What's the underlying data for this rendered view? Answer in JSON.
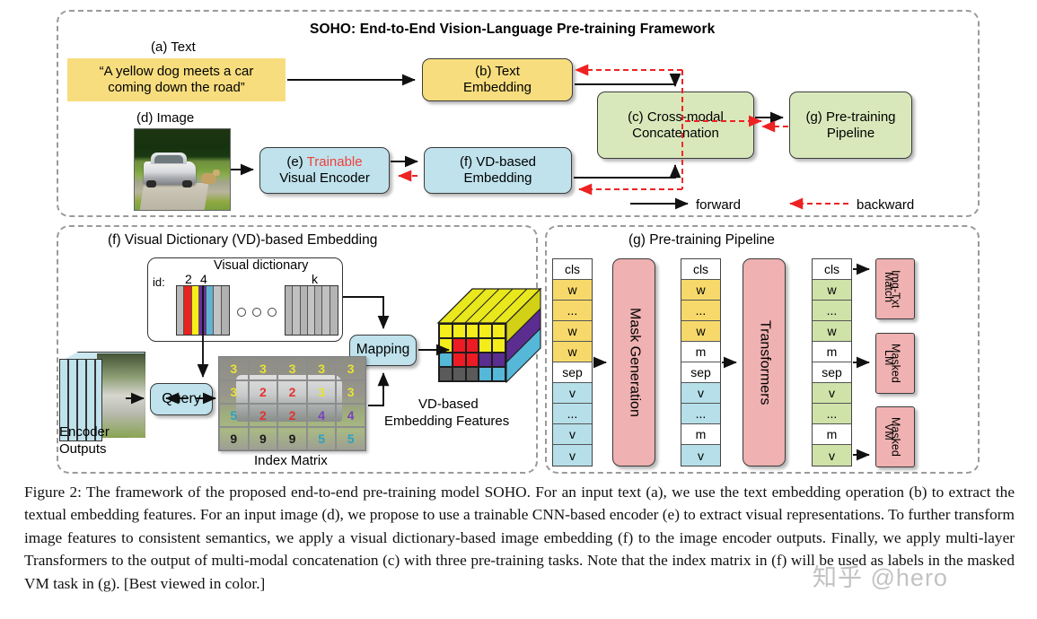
{
  "figure": {
    "top_panel_title": "SOHO: End-to-End Vision-Language Pre-training Framework",
    "labels": {
      "a_text": "(a) Text",
      "d_image": "(d) Image"
    },
    "text_sample_line1": "“A yellow dog meets a car",
    "text_sample_line2": "coming down the road”",
    "boxes": {
      "b_line1": "(b) Text",
      "b_line2": "Embedding",
      "e_line1_prefix": "(e) ",
      "e_line1_red": "Trainable",
      "e_line2": "Visual Encoder",
      "f_line1": "(f) VD-based",
      "f_line2": "Embedding",
      "c_line1": "(c) Cross-modal",
      "c_line2": "Concatenation",
      "g_line1": "(g) Pre-training",
      "g_line2": "Pipeline"
    },
    "legend": {
      "forward": "forward",
      "backward": "backward"
    }
  },
  "panel_f": {
    "title": "(f) Visual Dictionary (VD)-based Embedding",
    "visual_dictionary_title": "Visual dictionary",
    "id_label": "id:",
    "id_2": "2",
    "id_4": "4",
    "id_k": "k",
    "encoder_outputs_line1": "Encoder",
    "encoder_outputs_line2": "Outputs",
    "query_label": "Query",
    "mapping_label": "Mapping",
    "index_matrix_label": "Index Matrix",
    "vd_features_line1": "VD-based",
    "vd_features_line2": "Embedding Features",
    "dictionary_bars": [
      {
        "color": "#b9b9b9"
      },
      {
        "color": "#e8231f"
      },
      {
        "color": "#f9ee16"
      },
      {
        "color": "#6b2fa0"
      },
      {
        "color": "#5fb4d4"
      },
      {
        "color": "#c3c3c3"
      },
      {
        "color": "#b0b0b0"
      }
    ],
    "dictionary_bars_k": [
      {
        "color": "#b4b4b4"
      },
      {
        "color": "#c0c0c0"
      },
      {
        "color": "#b4b4b4"
      },
      {
        "color": "#c4c4c4"
      },
      {
        "color": "#b4b4b4"
      },
      {
        "color": "#c0c0c0"
      },
      {
        "color": "#b4b4b4"
      }
    ],
    "index_matrix": [
      [
        {
          "v": "3",
          "c": "#e8e234"
        },
        {
          "v": "3",
          "c": "#e8e234"
        },
        {
          "v": "3",
          "c": "#e8e234"
        },
        {
          "v": "3",
          "c": "#e8e234"
        },
        {
          "v": "3",
          "c": "#e8e234"
        }
      ],
      [
        {
          "v": "3",
          "c": "#e8e234"
        },
        {
          "v": "2",
          "c": "#e0342f"
        },
        {
          "v": "2",
          "c": "#e0342f"
        },
        {
          "v": "3",
          "c": "#e8e234"
        },
        {
          "v": "3",
          "c": "#e8e234"
        }
      ],
      [
        {
          "v": "5",
          "c": "#2f9fc4"
        },
        {
          "v": "2",
          "c": "#e0342f"
        },
        {
          "v": "2",
          "c": "#e0342f"
        },
        {
          "v": "4",
          "c": "#7b3fbd"
        },
        {
          "v": "4",
          "c": "#7b3fbd"
        }
      ],
      [
        {
          "v": "9",
          "c": "#1c1c1c"
        },
        {
          "v": "9",
          "c": "#1c1c1c"
        },
        {
          "v": "9",
          "c": "#1c1c1c"
        },
        {
          "v": "5",
          "c": "#2f9fc4"
        },
        {
          "v": "5",
          "c": "#2f9fc4"
        }
      ]
    ],
    "cube_front": [
      [
        "#f4ec1b",
        "#f4ec1b",
        "#f4ec1b",
        "#f4ec1b",
        "#f4ec1b"
      ],
      [
        "#f4ec1b",
        "#ed1c24",
        "#ed1c24",
        "#f4ec1b",
        "#f4ec1b"
      ],
      [
        "#55b8d8",
        "#ed1c24",
        "#ed1c24",
        "#5b2d91",
        "#5b2d91"
      ],
      [
        "#5a5a5a",
        "#5a5a5a",
        "#5a5a5a",
        "#55b8d8",
        "#55b8d8"
      ]
    ]
  },
  "panel_g": {
    "title": "(g) Pre-training Pipeline",
    "mask_generation": "Mask Generation",
    "transformers": "Transformers",
    "column1": [
      {
        "t": "cls",
        "k": "p"
      },
      {
        "t": "w",
        "k": "w"
      },
      {
        "t": "...",
        "k": "w"
      },
      {
        "t": "w",
        "k": "w"
      },
      {
        "t": "w",
        "k": "w"
      },
      {
        "t": "sep",
        "k": "p"
      },
      {
        "t": "v",
        "k": "v"
      },
      {
        "t": "...",
        "k": "v"
      },
      {
        "t": "v",
        "k": "v"
      },
      {
        "t": "v",
        "k": "v"
      }
    ],
    "column2": [
      {
        "t": "cls",
        "k": "p"
      },
      {
        "t": "w",
        "k": "w"
      },
      {
        "t": "...",
        "k": "w"
      },
      {
        "t": "w",
        "k": "w"
      },
      {
        "t": "m",
        "k": "p"
      },
      {
        "t": "sep",
        "k": "p"
      },
      {
        "t": "v",
        "k": "v"
      },
      {
        "t": "...",
        "k": "v"
      },
      {
        "t": "m",
        "k": "p"
      },
      {
        "t": "v",
        "k": "v"
      }
    ],
    "column3": [
      {
        "t": "cls",
        "k": "p"
      },
      {
        "t": "w",
        "k": "g"
      },
      {
        "t": "...",
        "k": "g"
      },
      {
        "t": "w",
        "k": "g"
      },
      {
        "t": "m",
        "k": "p"
      },
      {
        "t": "sep",
        "k": "p"
      },
      {
        "t": "v",
        "k": "g"
      },
      {
        "t": "...",
        "k": "g"
      },
      {
        "t": "m",
        "k": "p"
      },
      {
        "t": "v",
        "k": "g"
      }
    ],
    "tasks": [
      {
        "line1": "Img-Txt",
        "line2": "Match"
      },
      {
        "line1": "Masked",
        "line2": "LM"
      },
      {
        "line1": "Masked",
        "line2": "VM"
      }
    ]
  },
  "caption": "Figure 2:  The framework of the proposed end-to-end pre-training model SOHO. For an input text (a), we use the text embedding operation (b) to extract the textual embedding features. For an input image (d), we propose to use a trainable CNN-based encoder (e) to extract visual representations. To further transform image features to consistent semantics, we apply a visual dictionary-based image embedding (f) to the image encoder outputs. Finally, we apply multi-layer Transformers to the output of multi-modal concatenation (c) with three pre-training tasks. Note that the index matrix in (f) will be used as labels in the masked VM task in (g). [Best viewed in color.]",
  "watermark": "知乎 @hero",
  "colors": {
    "yellow": "#f7dd7e",
    "cyan": "#bfe2ec",
    "green": "#d9e8bb",
    "pink": "#efb1b1",
    "backward_red": "#ee2222"
  }
}
